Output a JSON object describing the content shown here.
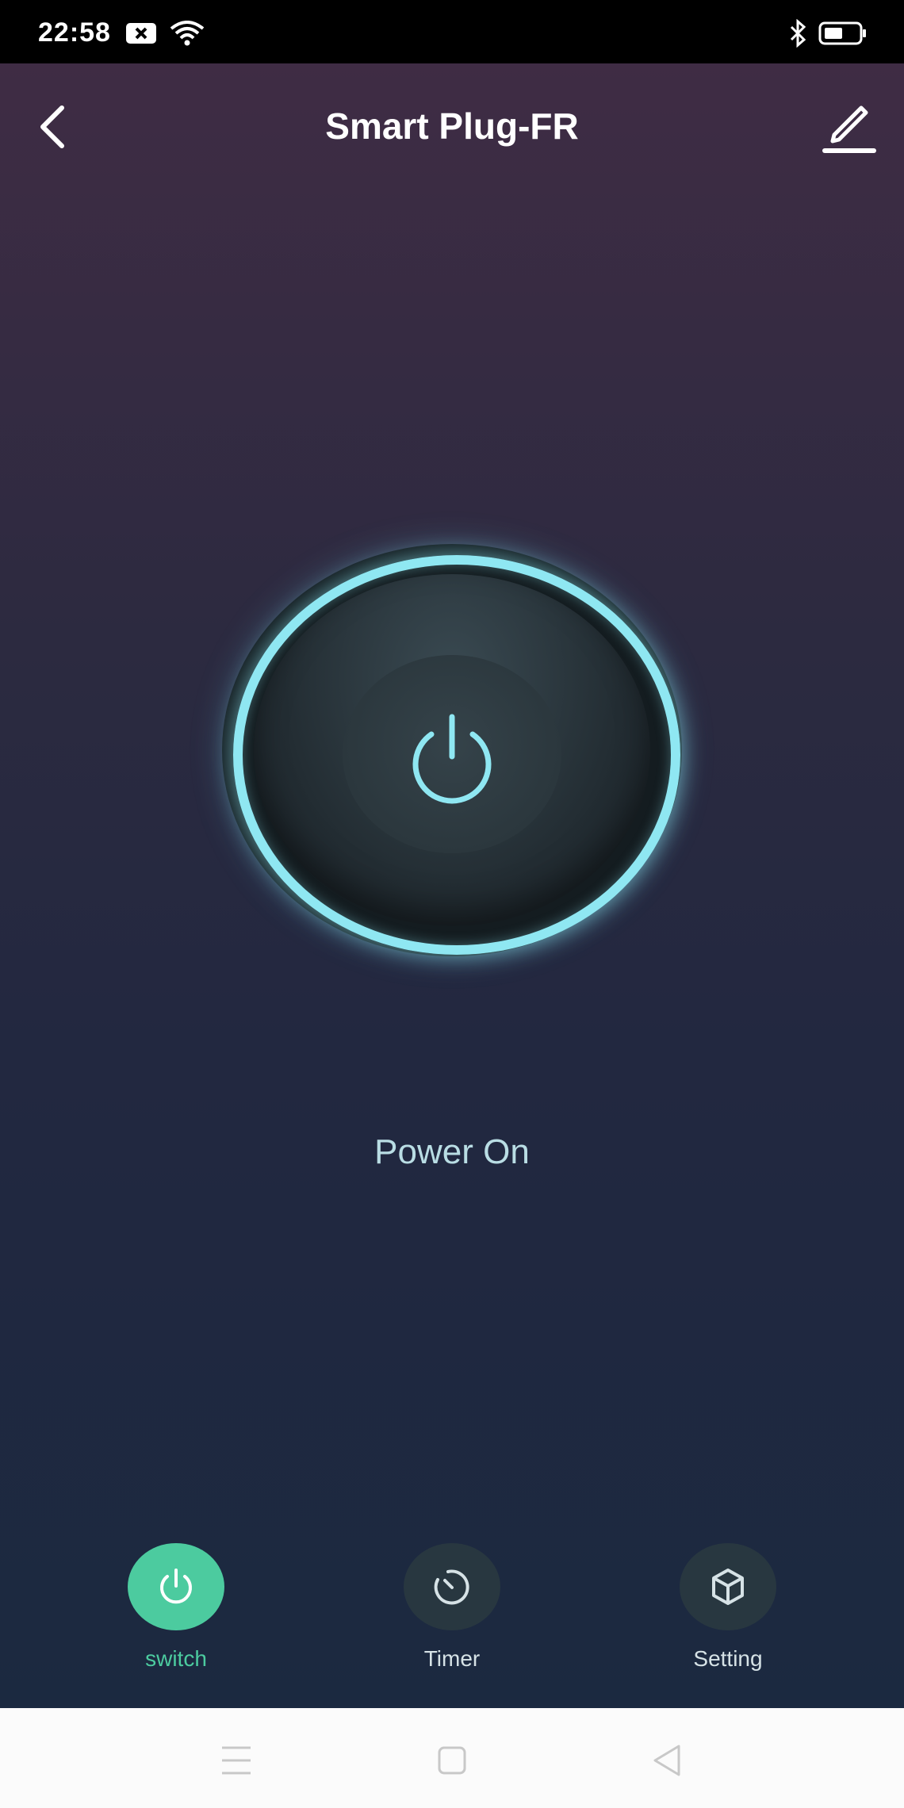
{
  "status_bar": {
    "time": "22:58",
    "icons": [
      "notification-x-icon",
      "wifi-icon",
      "bluetooth-icon",
      "battery-icon"
    ]
  },
  "header": {
    "title": "Smart Plug-FR",
    "back_icon": "back-chevron-icon",
    "edit_icon": "edit-pencil-icon"
  },
  "device": {
    "power_icon": "power-icon",
    "status_text": "Power On",
    "accent_color": "#8fe7f2"
  },
  "tabs": [
    {
      "label": "switch",
      "icon": "power-icon",
      "active": true
    },
    {
      "label": "Timer",
      "icon": "timer-icon",
      "active": false
    },
    {
      "label": "Setting",
      "icon": "cube-icon",
      "active": false
    }
  ],
  "colors": {
    "active_tab": "#4ccb9f",
    "ring_glow": "#8fe7f2"
  },
  "system_nav": {
    "icons": [
      "menu-icon",
      "home-icon",
      "back-triangle-icon"
    ]
  }
}
